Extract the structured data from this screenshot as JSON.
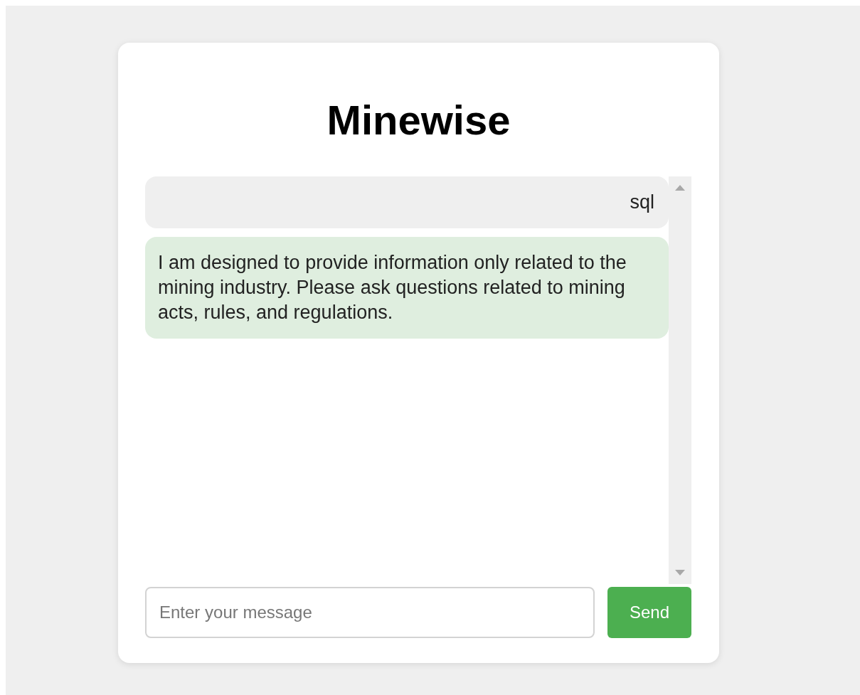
{
  "title": "Minewise",
  "messages": [
    {
      "kind": "user",
      "text": "sql"
    },
    {
      "kind": "bot",
      "text": "I am designed to provide information only related to the mining industry. Please ask questions related to mining acts, rules, and regulations."
    }
  ],
  "input": {
    "placeholder": "Enter your message"
  },
  "send_button": "Send"
}
